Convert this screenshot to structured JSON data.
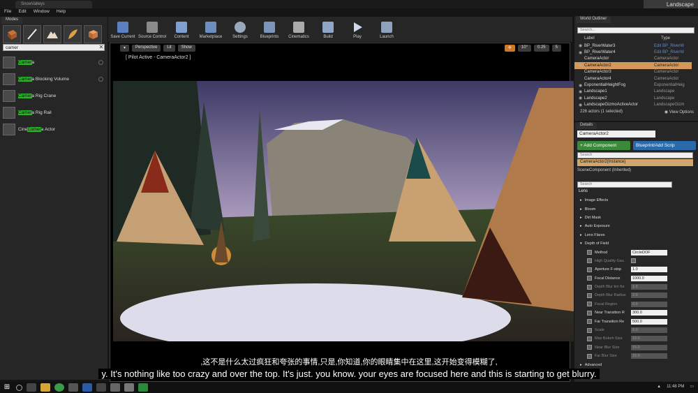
{
  "window": {
    "tab_title": "SnowValleys",
    "project": "Landscape"
  },
  "menu": [
    "File",
    "Edit",
    "Window",
    "Help"
  ],
  "modes": {
    "tab": "Modes",
    "search_value": "camer",
    "items": [
      {
        "match": "Camer",
        "rest": "a",
        "prefix": ""
      },
      {
        "match": "Camer",
        "rest": "a Blocking Volume",
        "prefix": ""
      },
      {
        "match": "Camer",
        "rest": "a Rig Crane",
        "prefix": ""
      },
      {
        "match": "Camer",
        "rest": "a Rig Rail",
        "prefix": ""
      },
      {
        "match": "Camer",
        "rest": "a Actor",
        "prefix": "Cine "
      }
    ]
  },
  "toolbar": [
    "Save Current",
    "Source Control",
    "Content",
    "Marketplace",
    "Settings",
    "Blueprints",
    "Cinematics",
    "Build",
    "Play",
    "Launch"
  ],
  "viewport": {
    "perspective": "Perspective",
    "lit": "Lit",
    "show": "Show",
    "pilot": "[ Pilot Active - CameraActor2 ]",
    "angle": "10°",
    "scale": "0.25",
    "cam_speed": "5"
  },
  "outliner": {
    "tab": "World Outliner",
    "search_placeholder": "Search...",
    "col_label": "Label",
    "col_type": "Type",
    "rows": [
      {
        "label": "BP_RiverWater3",
        "type": "Edit BP_RiverW"
      },
      {
        "label": "BP_RiverWater4",
        "type": "Edit BP_RiverW"
      },
      {
        "label": "CameraActor",
        "type": "CameraActor"
      },
      {
        "label": "CameraActor2",
        "type": "CameraActor"
      },
      {
        "label": "CameraActor3",
        "type": "CameraActor"
      },
      {
        "label": "CameraActor4",
        "type": "CameraActor"
      },
      {
        "label": "ExponentialHeightFog",
        "type": "ExponentialHeig"
      },
      {
        "label": "Landscape1",
        "type": "Landscape"
      },
      {
        "label": "Landscape2",
        "type": "Landscape"
      },
      {
        "label": "LandscapeGizmoActiveActor",
        "type": "LandscapeGizm"
      }
    ],
    "count": "226 actors (1 selected)",
    "view_options": "View Options"
  },
  "details": {
    "tab": "Details",
    "name": "CameraActor2",
    "add_component": "+ Add Component",
    "blueprint": "Blueprint/Add Scrip",
    "search": "Search",
    "instance": "CameraActor2(Instance)",
    "scene_comp": "SceneComponent (Inherited)",
    "search2": "Search",
    "section": "Lens",
    "groups": [
      "Image Effects",
      "Bloom",
      "Dirt Mask",
      "Auto Exposure",
      "Lens Flares",
      "Depth of Field"
    ],
    "props": [
      {
        "name": "Method",
        "value": "CircleDOF",
        "dim": false
      },
      {
        "name": "High Quality Gau",
        "value": "",
        "dim": true
      },
      {
        "name": "Aperture F-stop",
        "value": "1.0",
        "dim": false
      },
      {
        "name": "Focal Distance",
        "value": "1000.0",
        "dim": false
      },
      {
        "name": "Depth Blur km for",
        "value": "1.0",
        "dim": true
      },
      {
        "name": "Depth Blur Radius",
        "value": "2.0",
        "dim": true
      },
      {
        "name": "Focal Region",
        "value": "0.0",
        "dim": true
      },
      {
        "name": "Near Transition R",
        "value": "300.0",
        "dim": false
      },
      {
        "name": "Far Transition Re",
        "value": "500.0",
        "dim": false
      },
      {
        "name": "Scale",
        "value": "0.0",
        "dim": true
      },
      {
        "name": "Max Bokeh Size",
        "value": "15.0",
        "dim": true
      },
      {
        "name": "Near Blur Size",
        "value": "15.0",
        "dim": true
      },
      {
        "name": "Far Blur Size",
        "value": "15.0",
        "dim": true
      }
    ],
    "advanced": "Advanced"
  },
  "subtitles": {
    "cn": ",这不是什么太过疯狂和夸张的事情,只是,你知道,你的眼睛集中在这里,这开始变得模糊了,",
    "en": "y. It's nothing like too crazy and over the top. It's just. you know. your eyes are focused here and this is starting to get blurry."
  },
  "taskbar": {
    "time": "11:48 PM"
  }
}
